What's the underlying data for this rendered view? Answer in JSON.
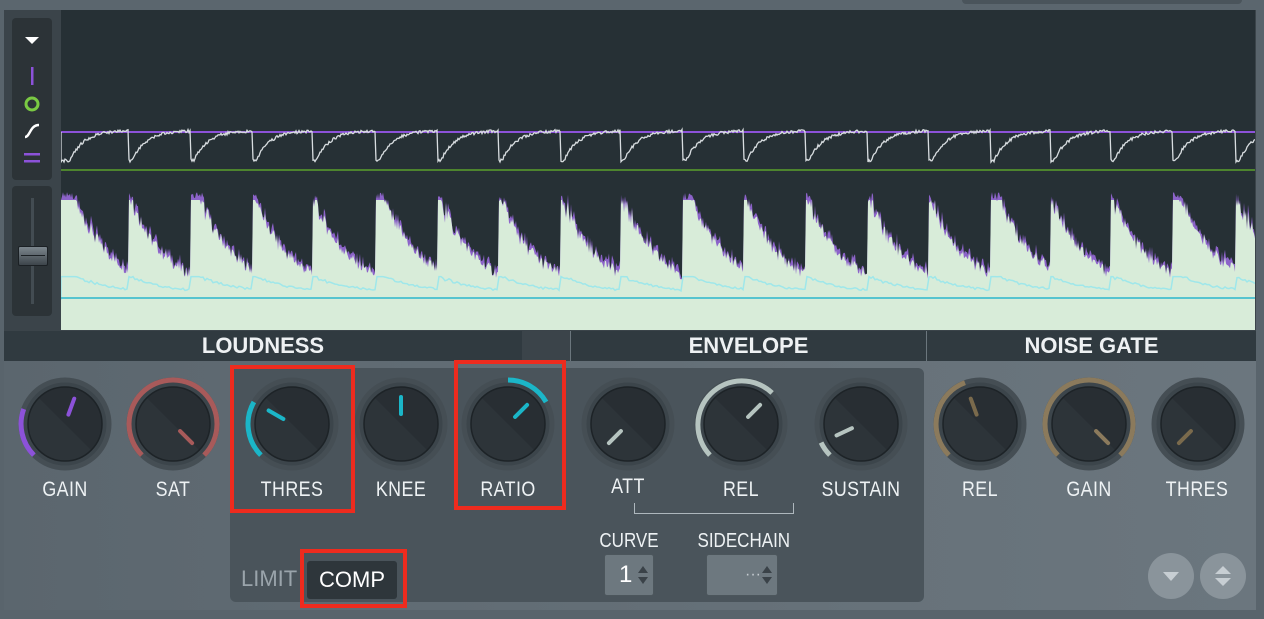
{
  "colors": {
    "accent_purple": "#8c52d9",
    "accent_cyan": "#1bb6c8",
    "accent_green": "#7ac943",
    "highlight_red": "#ee2b1e",
    "panel_bg": "#3b444a",
    "display_bg": "#263035"
  },
  "toolbar": {
    "icons": [
      "dropdown-arrow-icon",
      "vertical-line-icon",
      "circle-icon",
      "curve-icon",
      "double-line-icon"
    ],
    "slider_level": 0.45
  },
  "sections": {
    "loudness": "LOUDNESS",
    "envelope": "ENVELOPE",
    "noise_gate": "NOISE GATE"
  },
  "knobs": {
    "gain": {
      "label": "GAIN",
      "color": "#8c52d9"
    },
    "sat": {
      "label": "SAT",
      "color": "#a85a5a"
    },
    "thres": {
      "label": "THRES",
      "color": "#1bb6c8"
    },
    "knee": {
      "label": "KNEE",
      "color": "#1bb6c8"
    },
    "ratio": {
      "label": "RATIO",
      "color": "#1bb6c8"
    },
    "att": {
      "label": "ATT",
      "color": "#b6c4c0"
    },
    "rel": {
      "label": "REL",
      "color": "#b6c4c0"
    },
    "sustain": {
      "label": "SUSTAIN",
      "color": "#b6c4c0"
    },
    "gate_rel": {
      "label": "REL",
      "color": "#8b7a5c"
    },
    "gate_gain": {
      "label": "GAIN",
      "color": "#8b7a5c"
    },
    "gate_thres": {
      "label": "THRES",
      "color": "#8b7a5c"
    }
  },
  "mode": {
    "limit": "LIMIT",
    "comp": "COMP"
  },
  "curve": {
    "label": "CURVE",
    "value": "1"
  },
  "sidechain": {
    "label": "SIDECHAIN",
    "value": "···"
  },
  "bottom_buttons": [
    "down-arrow-icon",
    "up-down-arrow-icon"
  ]
}
